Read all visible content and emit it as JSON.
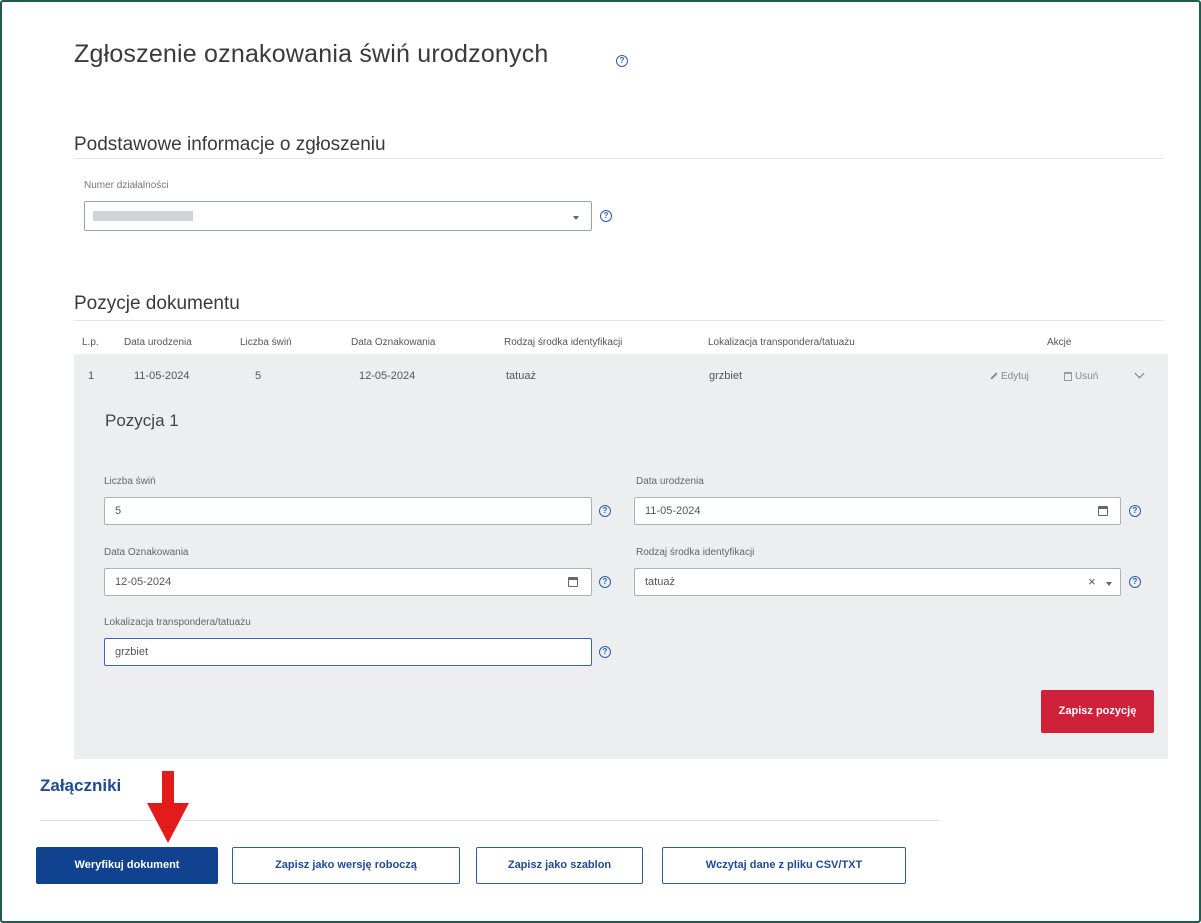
{
  "page": {
    "title": "Zgłoszenie oznakowania świń urodzonych",
    "help_icon": "help-circle-icon"
  },
  "basic_info": {
    "section_title": "Podstawowe informacje o zgłoszeniu",
    "activity_number_label": "Numer działalności",
    "activity_number_value": ""
  },
  "positions": {
    "section_title": "Pozycje dokumentu",
    "columns": [
      "L.p.",
      "Data urodzenia",
      "Liczba świń",
      "Data Oznakowania",
      "Rodzaj środka identyfikacji",
      "Lokalizacja transpondera/tatuażu",
      "Akcje"
    ],
    "rows": [
      {
        "lp": "1",
        "birth_date": "11-05-2024",
        "pig_count": "5",
        "marking_date": "12-05-2024",
        "id_type": "tatuaż",
        "location": "grzbiet",
        "edit_label": "Edytuj",
        "delete_label": "Usuń"
      }
    ]
  },
  "position_form": {
    "title": "Pozycja 1",
    "pig_count_label": "Liczba świń",
    "pig_count_value": "5",
    "birth_date_label": "Data urodzenia",
    "birth_date_value": "11-05-2024",
    "marking_date_label": "Data Oznakowania",
    "marking_date_value": "12-05-2024",
    "id_type_label": "Rodzaj środka identyfikacji",
    "id_type_value": "tatuaż",
    "location_label": "Lokalizacja transpondera/tatuażu",
    "location_value": "grzbiet",
    "save_button": "Zapisz pozycję"
  },
  "attachments": {
    "title": "Załączniki"
  },
  "footer_buttons": {
    "verify": "Weryfikuj dokument",
    "save_draft": "Zapisz jako wersję roboczą",
    "save_template": "Zapisz jako szablon",
    "load_csv": "Wczytaj dane z pliku CSV/TXT"
  },
  "colors": {
    "primary": "#10428f",
    "danger": "#d0213a",
    "arrow": "#e31b1b",
    "panel_bg": "#eceef0"
  }
}
